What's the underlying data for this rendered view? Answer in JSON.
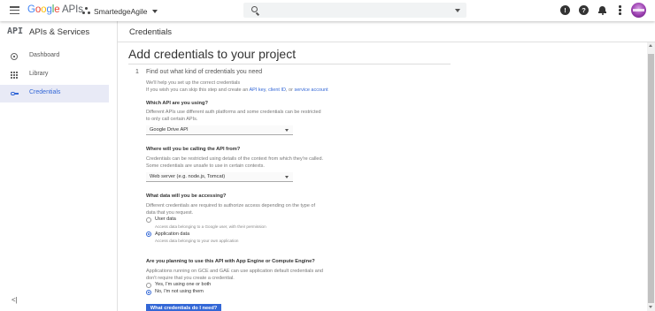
{
  "topbar": {
    "logo_google": [
      "G",
      "o",
      "o",
      "g",
      "l",
      "e"
    ],
    "logo_apis": " APIs",
    "project_name": "SmartedgeAgile",
    "search_placeholder": "",
    "help_icon_glyph": "?",
    "support_icon_glyph": "!"
  },
  "sidebar": {
    "logo": "API",
    "title": "APIs & Services",
    "items": [
      {
        "label": "Dashboard",
        "icon": "dashboard-icon",
        "active": false
      },
      {
        "label": "Library",
        "icon": "library-icon",
        "active": false
      },
      {
        "label": "Credentials",
        "icon": "key-icon",
        "active": true
      }
    ],
    "collapse_glyph": "<|"
  },
  "content": {
    "breadcrumb": "Credentials",
    "title": "Add credentials to your project",
    "step_number": "1",
    "step_title": "Find out what kind of credentials you need",
    "intro_line1": "We'll help you set up the correct credentials",
    "intro_line2_prefix": "If you wish you can skip this step and create an ",
    "intro_link_api_key": "API key",
    "intro_sep1": ", ",
    "intro_link_client_id": "client ID",
    "intro_sep2": ", or ",
    "intro_link_service_account": "service account",
    "q1": {
      "label": "Which API are you using?",
      "help1": "Different APIs use different auth platforms and some credentials can be restricted",
      "help2": "to only call certain APIs.",
      "value": "Google Drive API"
    },
    "q2": {
      "label": "Where will you be calling the API from?",
      "help1": "Credentials can be restricted using details of the context from which they're called.",
      "help2": "Some credentials are unsafe to use in certain contexts.",
      "value": "Web server (e.g. node.js, Tomcat)"
    },
    "q3": {
      "label": "What data will you be accessing?",
      "help1": "Different credentials are required to authorize access depending on the type of",
      "help2": "data that you request.",
      "options": [
        {
          "label": "User data",
          "hint": "Access data belonging to a Google user, with their permission",
          "selected": false
        },
        {
          "label": "Application data",
          "hint": "Access data belonging to your own application",
          "selected": true
        }
      ]
    },
    "q4": {
      "label": "Are you planning to use this API with App Engine or Compute Engine?",
      "help1": "Applications running on GCE and GAE can use application default credentials and",
      "help2": "don't require that you create a credential.",
      "options": [
        {
          "label": "Yes, I'm using one or both",
          "selected": false
        },
        {
          "label": "No, I'm not using them",
          "selected": true
        }
      ]
    },
    "cta_label": "What credentials do I need?"
  },
  "colors": {
    "accent": "#3367d6",
    "active_nav_bg": "#e8eaf6",
    "google_blue": "#4285F4",
    "google_red": "#EA4335",
    "google_yellow": "#FBBC05",
    "google_green": "#34A853"
  }
}
